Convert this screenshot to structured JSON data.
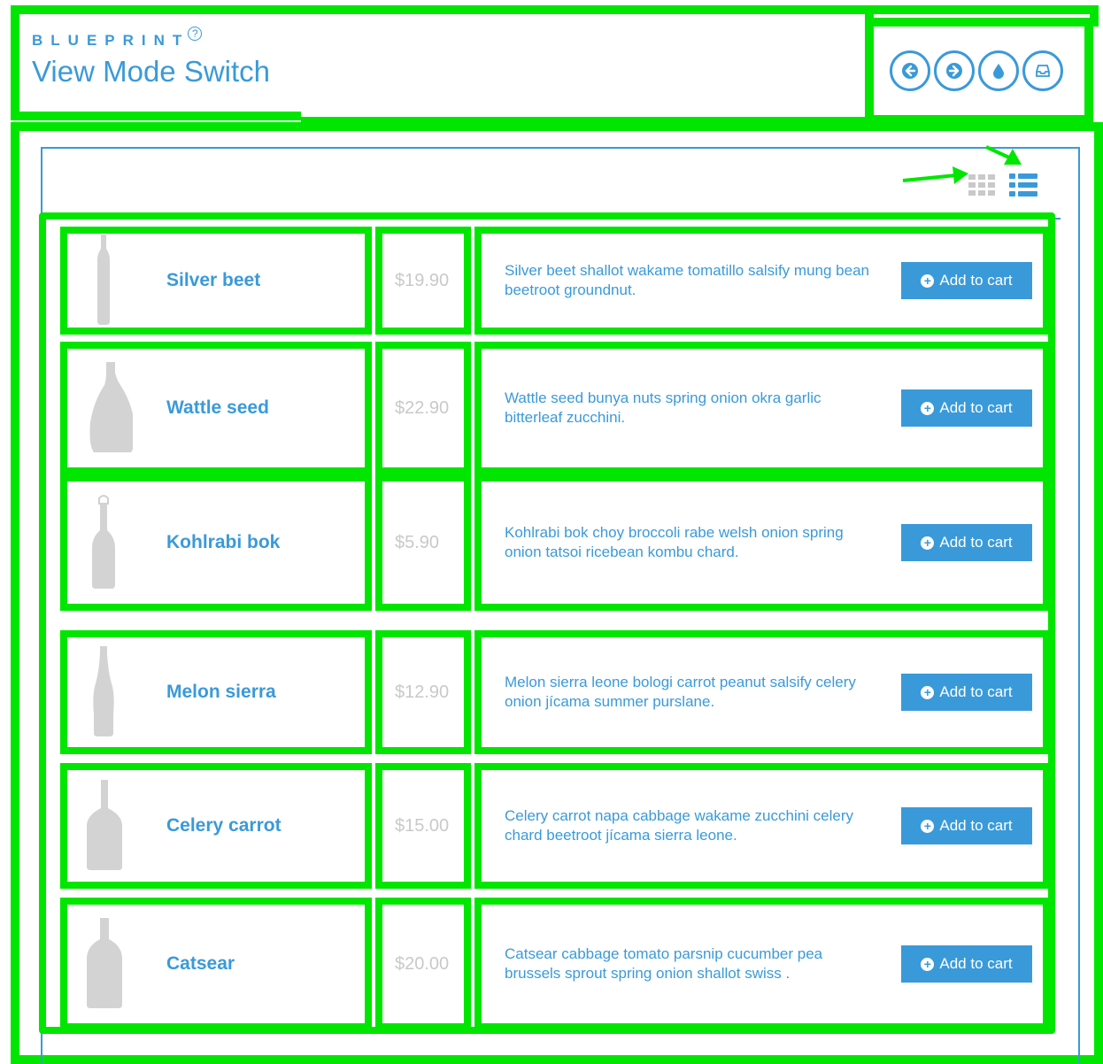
{
  "header": {
    "brand": "BLUEPRINT",
    "help_icon": "?",
    "title": "View Mode Switch"
  },
  "nav": [
    {
      "icon": "arrow-left-icon"
    },
    {
      "icon": "arrow-right-icon"
    },
    {
      "icon": "drop-icon"
    },
    {
      "icon": "inbox-icon"
    }
  ],
  "view_toggle": {
    "active": "list"
  },
  "colors": {
    "accent": "#3a9ad9",
    "highlight": "#00e600",
    "muted": "#c9c9c9"
  },
  "products": [
    {
      "name": "Silver beet",
      "price": "$19.90",
      "description": "Silver beet shallot wakame tomatillo salsify mung bean beetroot groundnut.",
      "button": "Add to cart",
      "bottle": "slim"
    },
    {
      "name": "Wattle seed",
      "price": "$22.90",
      "description": "Wattle seed bunya nuts spring onion okra garlic bitterleaf zucchini.",
      "button": "Add to cart",
      "bottle": "wide"
    },
    {
      "name": "Kohlrabi bok",
      "price": "$5.90",
      "description": "Kohlrabi bok choy broccoli rabe welsh onion spring onion tatsoi ricebean kombu chard.",
      "button": "Add to cart",
      "bottle": "swing"
    },
    {
      "name": "Melon sierra",
      "price": "$12.90",
      "description": "Melon sierra leone bologi carrot peanut salsify celery onion jícama summer purslane.",
      "button": "Add to cart",
      "bottle": "soda"
    },
    {
      "name": "Celery carrot",
      "price": "$15.00",
      "description": "Celery carrot napa cabbage wakame zucchini celery chard beetroot jícama sierra leone.",
      "button": "Add to cart",
      "bottle": "square"
    },
    {
      "name": "Catsear",
      "price": "$20.00",
      "description": "Catsear cabbage tomato parsnip cucumber pea brussels sprout spring onion shallot swiss .",
      "button": "Add to cart",
      "bottle": "whisky"
    }
  ]
}
